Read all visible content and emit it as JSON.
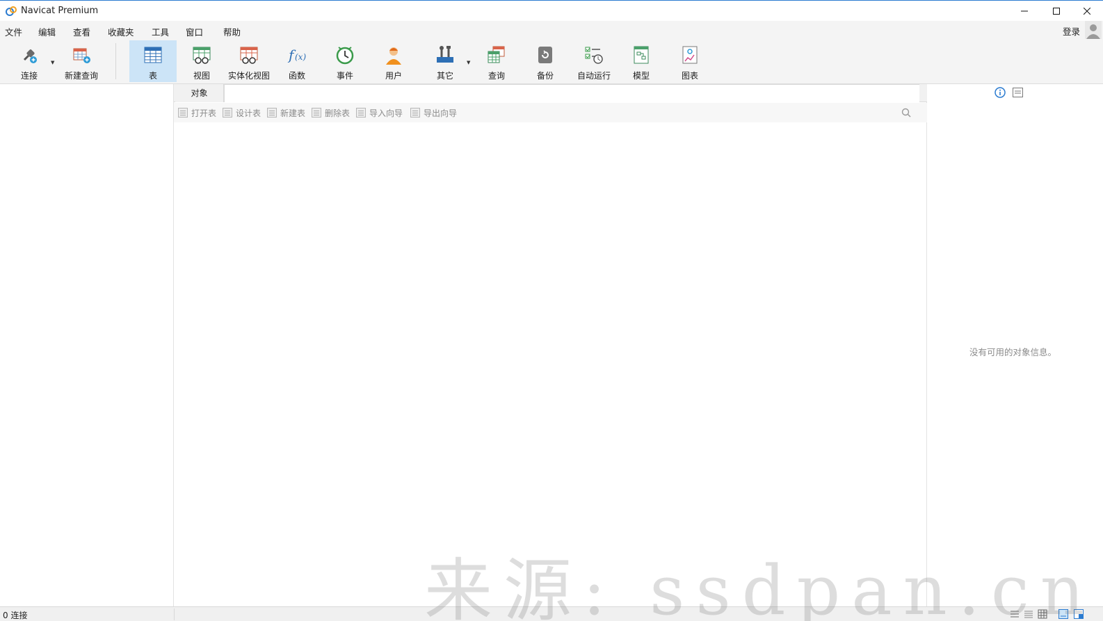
{
  "window": {
    "title": "Navicat Premium"
  },
  "menu": {
    "items": [
      "文件",
      "编辑",
      "查看",
      "收藏夹",
      "工具",
      "窗口",
      "帮助"
    ],
    "login": "登录"
  },
  "toolbar": {
    "connect": "连接",
    "new_query": "新建查询",
    "table": "表",
    "view": "视图",
    "mat_view": "实体化视图",
    "function": "函数",
    "event": "事件",
    "user": "用户",
    "other": "其它",
    "query": "查询",
    "backup": "备份",
    "automation": "自动运行",
    "model": "模型",
    "chart": "图表"
  },
  "tabs": {
    "objects": "对象"
  },
  "object_toolbar": {
    "open_table": "打开表",
    "design_table": "设计表",
    "new_table": "新建表",
    "delete_table": "删除表",
    "import_wizard": "导入向导",
    "export_wizard": "导出向导"
  },
  "info_panel": {
    "empty_message": "没有可用的对象信息。"
  },
  "status": {
    "connections": "0 连接"
  },
  "watermark": {
    "text": "来源: ssdpan.cn"
  },
  "colors": {
    "accent": "#2b7bd0",
    "active_tool": "#cce4f7"
  }
}
